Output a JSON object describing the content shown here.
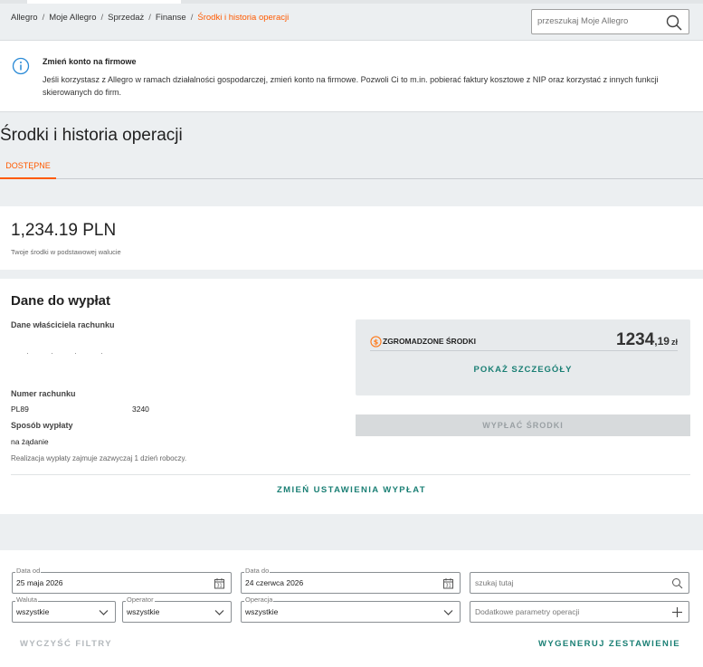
{
  "breadcrumb": {
    "items": [
      "Allegro",
      "Moje Allegro",
      "Sprzedaż",
      "Finanse"
    ],
    "current": "Środki i historia operacji",
    "separator": "/"
  },
  "search": {
    "placeholder": "przeszukaj Moje Allegro",
    "icon": "search-icon"
  },
  "info_banner": {
    "icon": "info-icon",
    "title": "Zmień konto na firmowe",
    "text": "Jeśli korzystasz z Allegro w ramach działalności gospodarczej, zmień konto na firmowe. Pozwoli Ci to m.in. pobierać faktury kosztowe z NIP oraz korzystać z innych funkcji skierowanych do firm."
  },
  "page": {
    "title": "Środki i historia operacji",
    "tabs": [
      {
        "label": "DOSTĘPNE",
        "active": true
      }
    ]
  },
  "balance": {
    "amount": "1,234.19 PLN",
    "caption": "Twoje środki w podstawowej walucie"
  },
  "payout": {
    "title": "Dane do wypłat",
    "owner_label": "Dane właściciela rachunku",
    "account_label": "Numer rachunku",
    "account_start": "PL89",
    "account_end": "3240",
    "method_label": "Sposób wypłaty",
    "method_value": "na żądanie",
    "method_note": "Realizacja wypłaty zajmuje zazwyczaj 1 dzień roboczy.",
    "collected": {
      "icon": "coin-icon",
      "label": "ZGROMADZONE ŚRODKI",
      "value_int": "1234",
      "value_cents": ",19",
      "currency": "zł",
      "details_label": "POKAŻ SZCZEGÓŁY"
    },
    "withdraw_label": "WYPŁAĆ ŚRODKI",
    "change_label": "ZMIEŃ USTAWIENIA WYPŁAT"
  },
  "filters": {
    "date_from": {
      "legend": "Data od",
      "value": "25 maja 2026"
    },
    "date_to": {
      "legend": "Data do",
      "value": "24 czerwca 2026"
    },
    "search": {
      "placeholder": "szukaj tutaj"
    },
    "currency": {
      "legend": "Waluta",
      "value": "wszystkie"
    },
    "operator": {
      "legend": "Operator",
      "value": "wszystkie"
    },
    "operation": {
      "legend": "Operacja",
      "value": "wszystkie"
    },
    "extra": {
      "placeholder": "Dodatkowe parametry operacji"
    },
    "clear_label": "WYCZYŚĆ FILTRY",
    "generate_label": "WYGENERUJ ZESTAWIENIE"
  },
  "colors": {
    "accent": "#ff5a00",
    "link": "#1a7f74",
    "info": "#2a8ad6",
    "coin": "#ff7a1a"
  }
}
